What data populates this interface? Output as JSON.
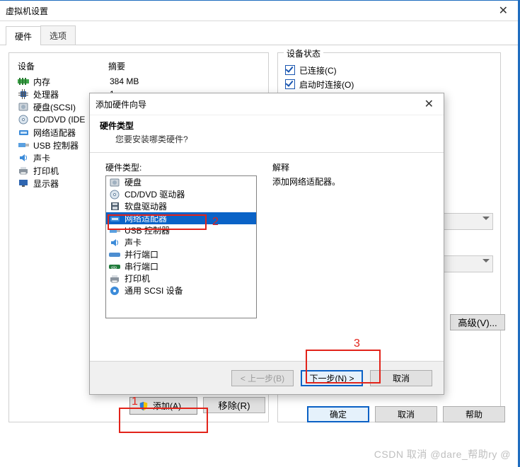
{
  "window": {
    "title": "虚拟机设置"
  },
  "tabs": {
    "hardware": "硬件",
    "options": "选项"
  },
  "deviceList": {
    "header": {
      "device": "设备",
      "summary": "摘要"
    },
    "rows": [
      {
        "icon": "memory",
        "label": "内存",
        "value": "384 MB"
      },
      {
        "icon": "cpu",
        "label": "处理器",
        "value": "1"
      },
      {
        "icon": "disk",
        "label": "硬盘(SCSI)",
        "value": ""
      },
      {
        "icon": "cd",
        "label": "CD/DVD (IDE",
        "value": ""
      },
      {
        "icon": "net",
        "label": "网络适配器",
        "value": ""
      },
      {
        "icon": "usb",
        "label": "USB 控制器",
        "value": ""
      },
      {
        "icon": "sound",
        "label": "声卡",
        "value": ""
      },
      {
        "icon": "printer",
        "label": "打印机",
        "value": ""
      },
      {
        "icon": "display",
        "label": "显示器",
        "value": ""
      }
    ]
  },
  "rightPanel": {
    "groupTitle": "设备状态",
    "connected": "已连接(C)",
    "connectAtPower": "启动时连接(O)",
    "advanced": "高级(V)..."
  },
  "buttons": {
    "add": "添加(A)...",
    "remove": "移除(R)",
    "ok": "确定",
    "cancel": "取消",
    "help": "帮助"
  },
  "wizard": {
    "title": "添加硬件向导",
    "heading": "硬件类型",
    "sub": "您要安装哪类硬件?",
    "listLabel": "硬件类型:",
    "items": [
      {
        "icon": "disk",
        "label": "硬盘"
      },
      {
        "icon": "cd",
        "label": "CD/DVD 驱动器"
      },
      {
        "icon": "floppy",
        "label": "软盘驱动器"
      },
      {
        "icon": "net",
        "label": "网络适配器",
        "selected": true
      },
      {
        "icon": "usb",
        "label": "USB 控制器"
      },
      {
        "icon": "sound",
        "label": "声卡"
      },
      {
        "icon": "parallel",
        "label": "并行端口"
      },
      {
        "icon": "serial",
        "label": "串行端口"
      },
      {
        "icon": "printer",
        "label": "打印机"
      },
      {
        "icon": "scsi",
        "label": "通用 SCSI 设备"
      }
    ],
    "explainLabel": "解释",
    "explainText": "添加网络适配器。",
    "back": "< 上一步(B)",
    "next": "下一步(N) >",
    "cancel": "取消"
  },
  "annotations": {
    "a1": "1",
    "a2": "2",
    "a3": "3"
  },
  "watermark": "CSDN 取消 @dare_帮助ry @"
}
